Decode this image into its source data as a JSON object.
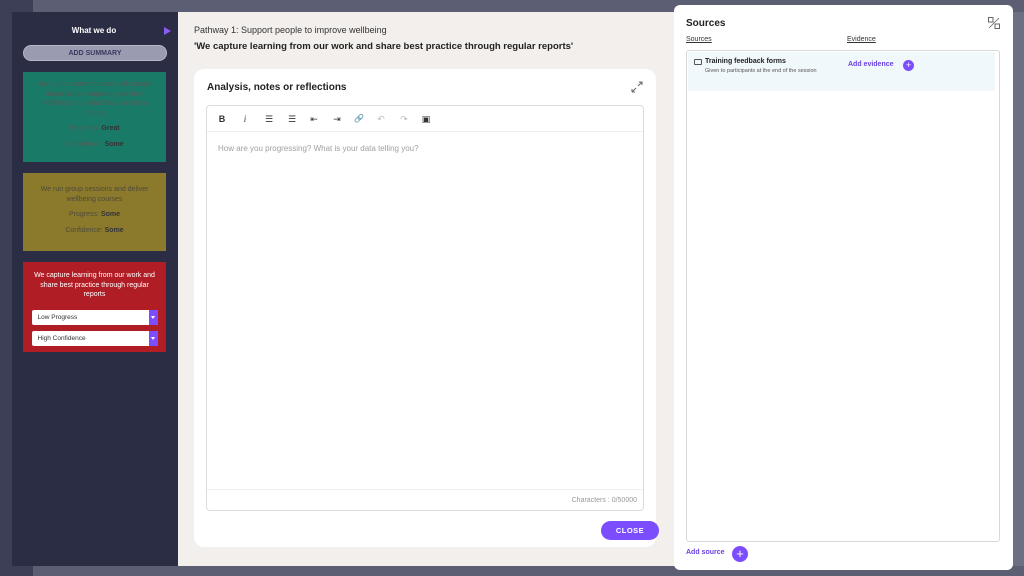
{
  "sidebar": {
    "title": "What we do",
    "add_summary": "ADD SUMMARY",
    "cards": [
      {
        "text": "Have good conversations with people about factors impacting on their wellbeing and what they can do to change",
        "progress_label": "Progress:",
        "progress_value": "Great",
        "confidence_label": "Confidence:",
        "confidence_value": "Some"
      },
      {
        "text": "We run group sessions and deliver wellbeing courses",
        "progress_label": "Progress:",
        "progress_value": "Some",
        "confidence_label": "Confidence:",
        "confidence_value": "Some"
      },
      {
        "text": "We capture learning from our work and share best practice through regular reports",
        "progress_select": "Low Progress",
        "confidence_select": "High Confidence"
      }
    ]
  },
  "main": {
    "pathway": "Pathway 1: Support people to improve wellbeing",
    "statement": "'We capture learning from our work and share best practice through regular reports'",
    "notes_title": "Analysis, notes or reflections",
    "toolbar": {
      "bold": "B",
      "italic": "i",
      "ordered_list": "☰",
      "bullet_list": "☰",
      "outdent": "⇤",
      "indent": "⇥",
      "link": "🔗",
      "undo": "↶",
      "redo": "↷",
      "image": "▣"
    },
    "placeholder": "How are you progressing? What is your data telling you?",
    "char_count": "Characters : 0/50000",
    "close_label": "CLOSE"
  },
  "sources": {
    "title": "Sources",
    "col_sources": "Sources",
    "col_evidence": "Evidence",
    "items": [
      {
        "name": "Training feedback forms",
        "description": "Given to participants at the end of the session",
        "add_evidence": "Add evidence"
      }
    ],
    "add_source": "Add source"
  },
  "colors": {
    "accent": "#7c4dff",
    "green_card": "#1a7a68",
    "yellow_card": "#8c7a2c",
    "red_card": "#b01d24",
    "sidebar_bg": "#2b2d45"
  }
}
